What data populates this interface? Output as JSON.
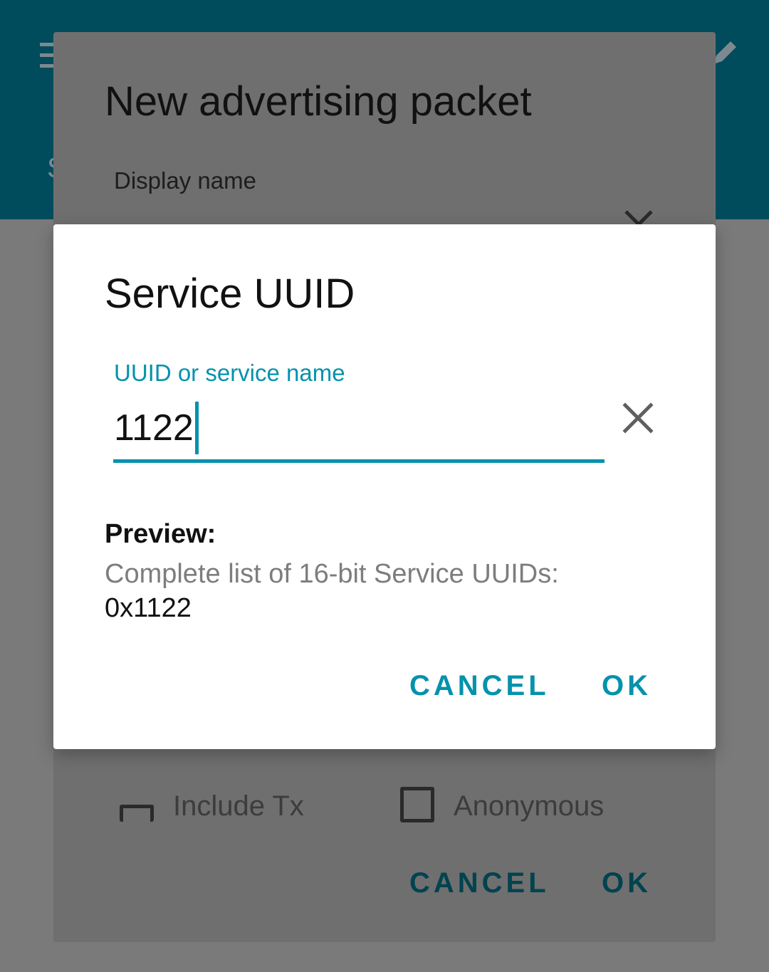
{
  "background_dialog": {
    "title": "New advertising packet",
    "display_name_label": "Display name",
    "include_tx_label": "Include Tx",
    "anonymous_label": "Anonymous",
    "cancel_label": "CANCEL",
    "ok_label": "OK"
  },
  "dialog": {
    "title": "Service UUID",
    "field": {
      "label": "UUID or service name",
      "value": "1122"
    },
    "preview": {
      "heading": "Preview:",
      "description": "Complete list of 16-bit Service UUIDs:",
      "value": "0x1122"
    },
    "buttons": {
      "cancel_label": "CANCEL",
      "ok_label": "OK"
    }
  },
  "colors": {
    "accent": "#0492ad",
    "app_bar": "#004b5c",
    "scrim": "#7a7a7a"
  },
  "icons": [
    "menu-icon",
    "edit-icon",
    "close-icon"
  ]
}
